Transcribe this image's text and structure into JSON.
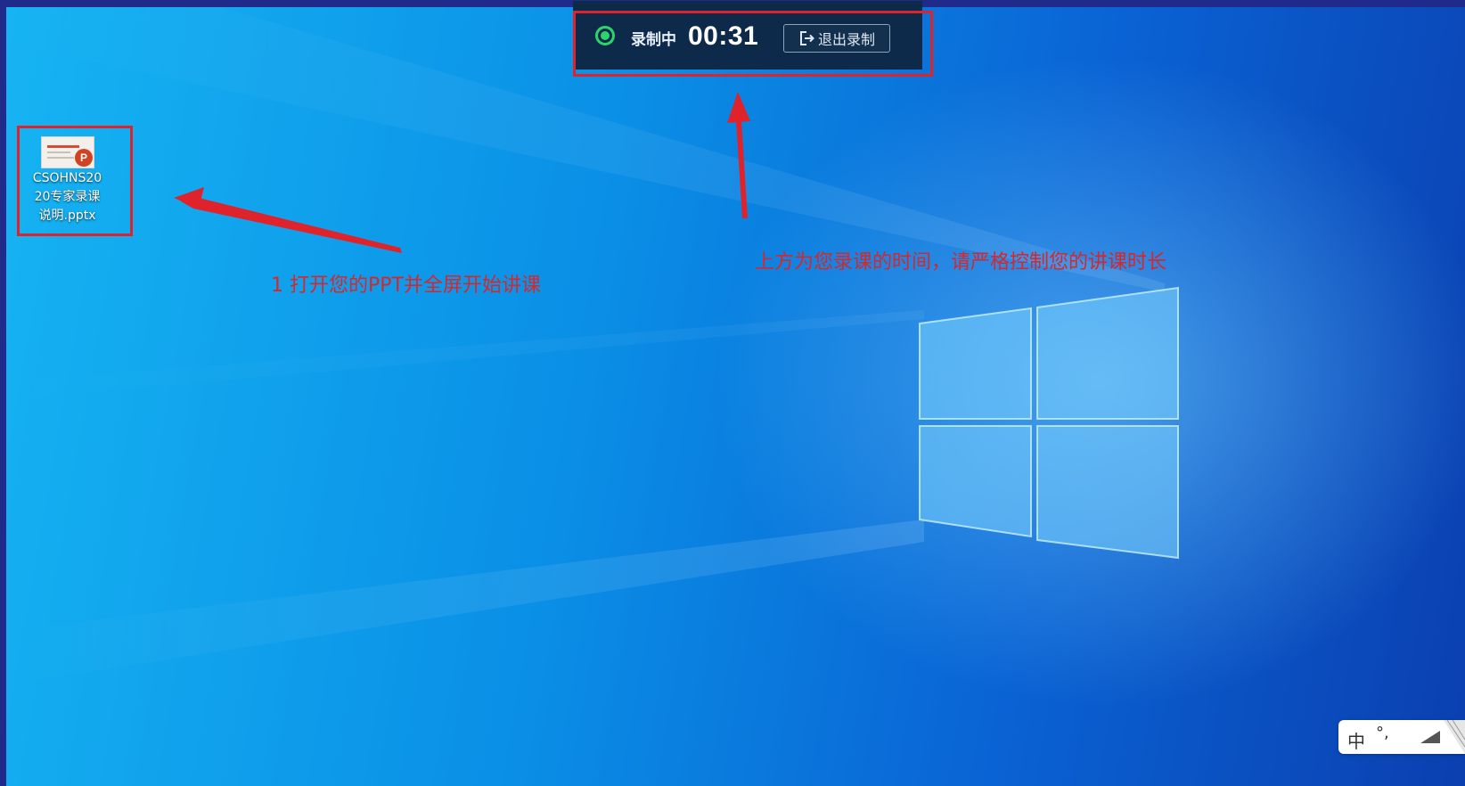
{
  "recorder": {
    "status": "录制中",
    "time": "00:31",
    "exit_label": "退出录制"
  },
  "desktop": {
    "file_lines": [
      "CSOHNS20",
      "20专家录课",
      "说明.pptx"
    ]
  },
  "annotations": {
    "step1": "1 打开您的PPT并全屏开始讲课",
    "timer_note": "上方为您录课的时间，请严格控制您的讲课时长"
  },
  "ime": {
    "lang": "中",
    "punct": "°,"
  },
  "colors": {
    "highlight_red": "#e0232a",
    "record_green": "#2fd36b",
    "desktop_blue": "#0a8fe6"
  },
  "icons": [
    "powerpoint-file-icon",
    "exit-icon",
    "record-indicator-icon",
    "ime-toolbox-icon"
  ]
}
